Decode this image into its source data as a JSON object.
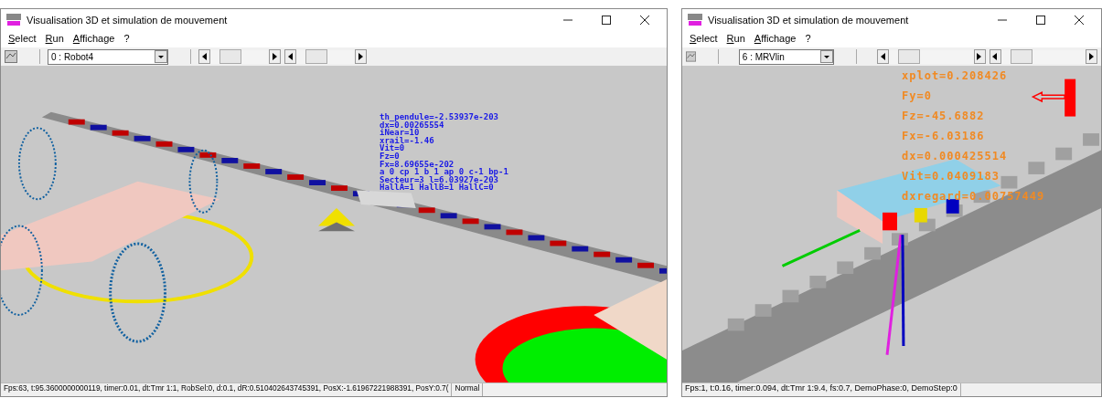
{
  "windows": [
    {
      "title": "Visualisation 3D et simulation de mouvement",
      "menu": [
        "Select",
        "Run",
        "Affichage",
        "?"
      ],
      "selector": "0 : Robot4",
      "kind": "track",
      "overlay": [
        "th_pendule=-2.53937e-203",
        "dx=0.00265554",
        "iNear=10",
        "xrail=-1.46",
        "Vit=0",
        "Fz=0",
        "Fx=8.69655e-202",
        "a 0 cp 1 b 1 ap 0 c-1 bp-1",
        "Secteur=3  l=6.03927e-203",
        "HallA=1 HallB=1 HallC=0"
      ],
      "status": [
        "Fps:63, t:95.3600000000119, timer:0.01, dt:Tmr 1:1, RobSel:0, d:0.1, dR:0.510402643745391, PosX:-1.61967221988391, PosY:0.7(",
        "Normal"
      ]
    },
    {
      "title": "Visualisation 3D et simulation de mouvement",
      "menu": [
        "Select",
        "Run",
        "Affichage",
        "?"
      ],
      "selector": "6 : MRVlin",
      "kind": "rack",
      "overlay": [
        "xplot=0.208426",
        "Fy=0",
        "Fz=-45.6882",
        "Fx=-6.03186",
        "dx=0.000425514",
        "Vit=0.0409183",
        "dxregard=0.00757449"
      ],
      "status": [
        "Fps:1, t:0.16, timer:0.094, dt:Tmr 1:9.4, fs:0.7, DemoPhase:0, DemoStep:0"
      ]
    }
  ]
}
